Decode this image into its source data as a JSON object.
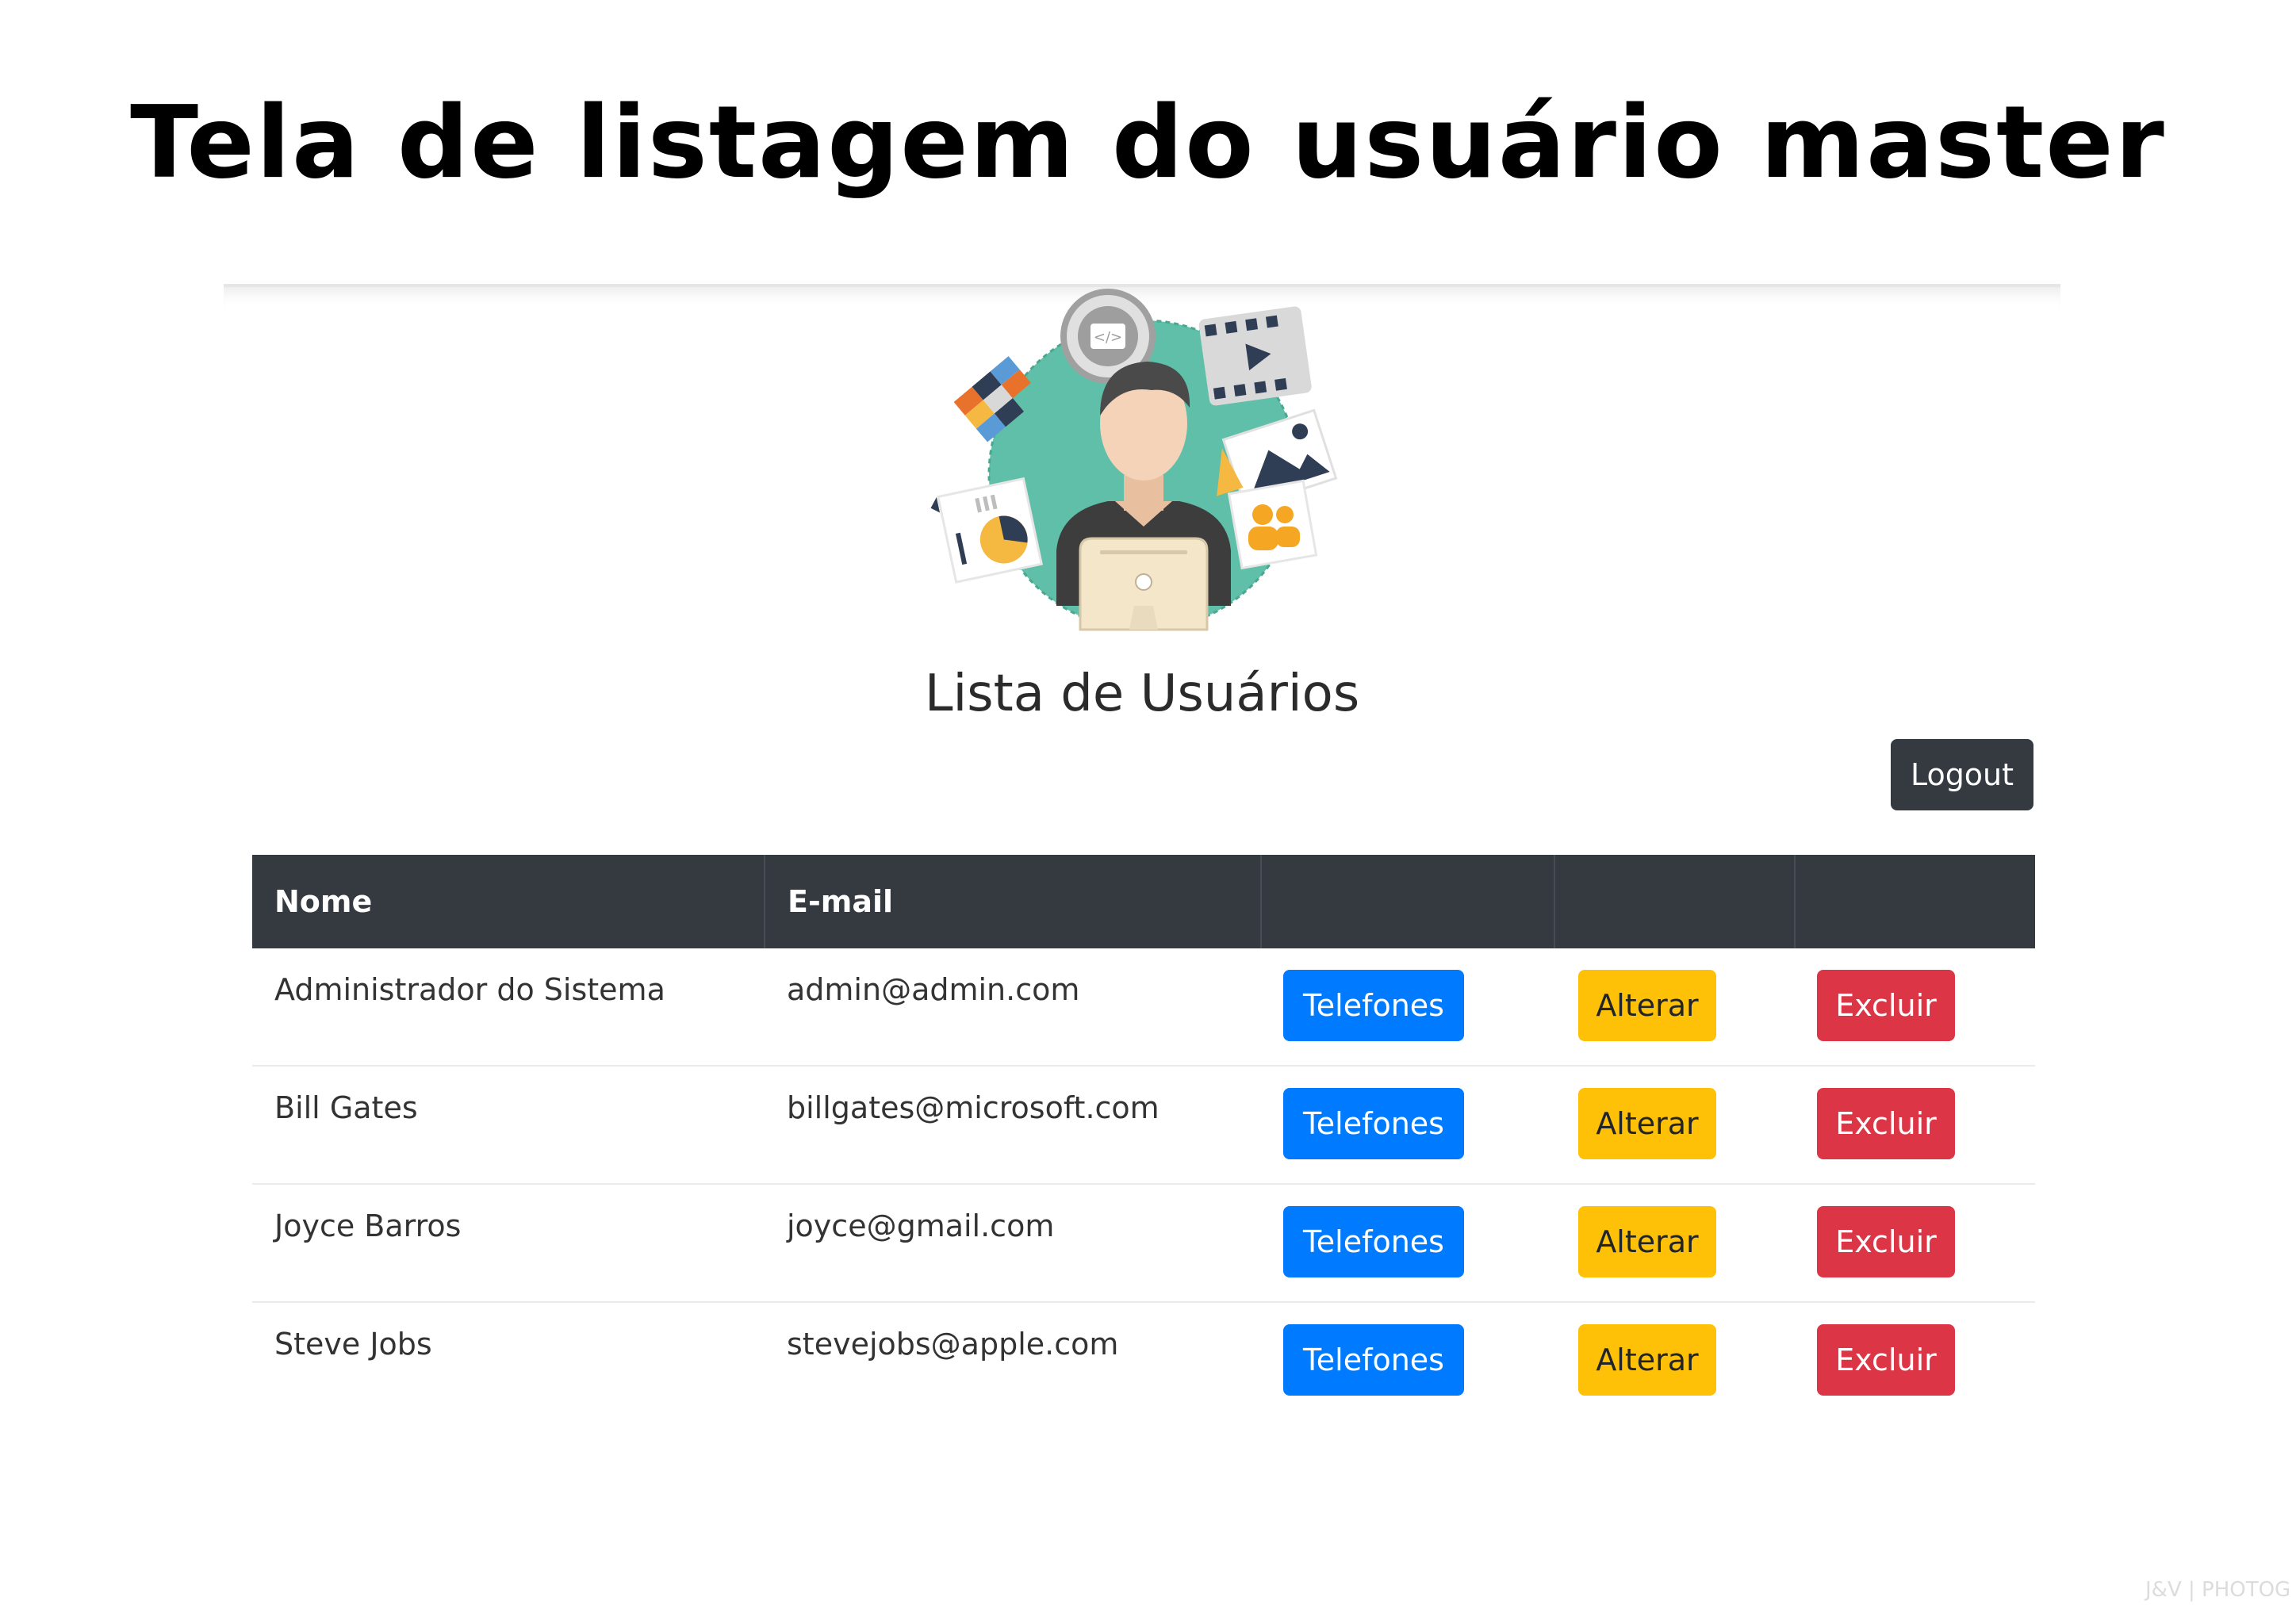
{
  "slide": {
    "title": "Tela de listagem do usuário master"
  },
  "page": {
    "heading": "Lista de Usuários",
    "logout_label": "Logout"
  },
  "table": {
    "headers": [
      "Nome",
      "E-mail",
      "",
      "",
      ""
    ],
    "rows": [
      {
        "name": "Administrador do Sistema",
        "email": "admin@admin.com",
        "phones_label": "Telefones",
        "edit_label": "Alterar",
        "delete_label": "Excluir"
      },
      {
        "name": "Bill Gates",
        "email": "billgates@microsoft.com",
        "phones_label": "Telefones",
        "edit_label": "Alterar",
        "delete_label": "Excluir"
      },
      {
        "name": "Joyce Barros",
        "email": "joyce@gmail.com",
        "phones_label": "Telefones",
        "edit_label": "Alterar",
        "delete_label": "Excluir"
      },
      {
        "name": "Steve Jobs",
        "email": "stevejobs@apple.com",
        "phones_label": "Telefones",
        "edit_label": "Alterar",
        "delete_label": "Excluir"
      }
    ]
  },
  "colors": {
    "dark": "#343a40",
    "primary": "#007bff",
    "warning": "#ffc107",
    "danger": "#dc3545",
    "avatar_circle": "#5fbfa8"
  },
  "icons": [
    "user-avatar-illustration",
    "code-icon",
    "film-icon",
    "palette-icon",
    "image-icon",
    "chart-icon",
    "group-icon"
  ],
  "watermark": "J&V | PHOTOG"
}
